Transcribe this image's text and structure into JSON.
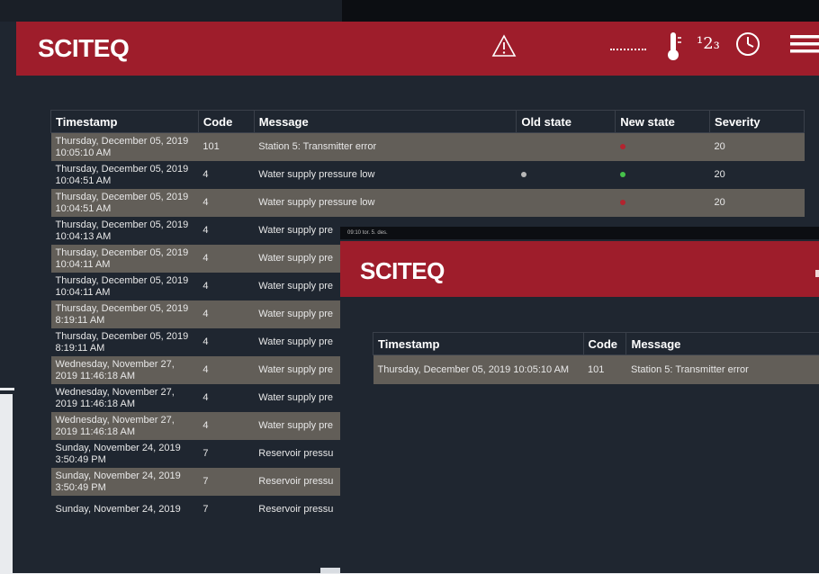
{
  "back_screen": {
    "logo": "SCITEQ",
    "header_icons": [
      "warning-icon",
      "thermometer-icon",
      "numeric-icon",
      "clock-icon",
      "menu-icon"
    ],
    "numeric_icon_label": "¹2₃",
    "columns": [
      "Timestamp",
      "Code",
      "Message",
      "Old state",
      "New state",
      "Severity"
    ],
    "rows": [
      {
        "timestamp": "Thursday, December 05, 2019 10:05:10 AM",
        "code": "101",
        "message": "Station 5: Transmitter error",
        "old": "",
        "new": "red",
        "severity": "20"
      },
      {
        "timestamp": "Thursday, December 05, 2019 10:04:51 AM",
        "code": "4",
        "message": "Water supply pressure low",
        "old": "gray",
        "new": "green",
        "severity": "20"
      },
      {
        "timestamp": "Thursday, December 05, 2019 10:04:51 AM",
        "code": "4",
        "message": "Water supply pressure low",
        "old": "",
        "new": "red",
        "severity": "20"
      },
      {
        "timestamp": "Thursday, December 05, 2019 10:04:13 AM",
        "code": "4",
        "message": "Water supply pre",
        "old": "",
        "new": "",
        "severity": ""
      },
      {
        "timestamp": "Thursday, December 05, 2019 10:04:11 AM",
        "code": "4",
        "message": "Water supply pre",
        "old": "",
        "new": "",
        "severity": ""
      },
      {
        "timestamp": "Thursday, December 05, 2019 10:04:11 AM",
        "code": "4",
        "message": "Water supply pre",
        "old": "",
        "new": "",
        "severity": ""
      },
      {
        "timestamp": "Thursday, December 05, 2019 8:19:11 AM",
        "code": "4",
        "message": "Water supply pre",
        "old": "",
        "new": "",
        "severity": ""
      },
      {
        "timestamp": "Thursday, December 05, 2019 8:19:11 AM",
        "code": "4",
        "message": "Water supply pre",
        "old": "",
        "new": "",
        "severity": ""
      },
      {
        "timestamp": "Wednesday, November 27, 2019 11:46:18 AM",
        "code": "4",
        "message": "Water supply pre",
        "old": "",
        "new": "",
        "severity": ""
      },
      {
        "timestamp": "Wednesday, November 27, 2019 11:46:18 AM",
        "code": "4",
        "message": "Water supply pre",
        "old": "",
        "new": "",
        "severity": ""
      },
      {
        "timestamp": "Wednesday, November 27, 2019 11:46:18 AM",
        "code": "4",
        "message": "Water supply pre",
        "old": "",
        "new": "",
        "severity": ""
      },
      {
        "timestamp": "Sunday, November 24, 2019 3:50:49 PM",
        "code": "7",
        "message": "Reservoir pressu",
        "old": "",
        "new": "",
        "severity": ""
      },
      {
        "timestamp": "Sunday, November 24, 2019 3:50:49 PM",
        "code": "7",
        "message": "Reservoir pressu",
        "old": "",
        "new": "",
        "severity": ""
      },
      {
        "timestamp": "Sunday, November 24, 2019",
        "code": "7",
        "message": "Reservoir pressu",
        "old": "",
        "new": "",
        "severity": ""
      }
    ]
  },
  "front_screen": {
    "status_text": "09:10  tor. 5. des.",
    "logo": "SCITEQ",
    "columns": [
      "Timestamp",
      "Code",
      "Message"
    ],
    "rows": [
      {
        "timestamp": "Thursday, December 05, 2019 10:05:10 AM",
        "code": "101",
        "message": "Station 5: Transmitter error"
      }
    ]
  },
  "colors": {
    "header_red": "#9e1d2b",
    "background": "#1f2630",
    "row_highlight": "#625e58",
    "state_red": "#b3242f",
    "state_green": "#46c24a",
    "state_gray": "#b8b8b8"
  }
}
